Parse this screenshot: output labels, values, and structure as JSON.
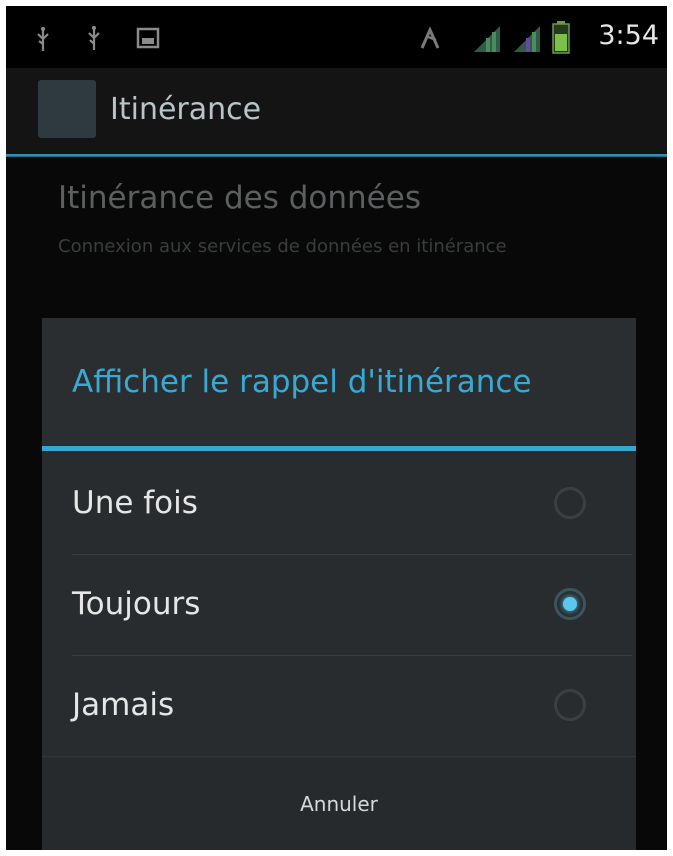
{
  "status_bar": {
    "time": "3:54",
    "icons": [
      "usb-icon",
      "usb-icon",
      "sd-card-icon",
      "vibrate-icon",
      "signal-icon",
      "signal-icon",
      "battery-icon"
    ]
  },
  "action_bar": {
    "title": "Itinérance",
    "app_icon": "settings-app-icon"
  },
  "preference": {
    "title": "Itinérance des données",
    "summary": "Connexion aux services de données en itinérance"
  },
  "dialog": {
    "title": "Afficher le rappel d'itinérance",
    "options": [
      {
        "label": "Une fois",
        "checked": false
      },
      {
        "label": "Toujours",
        "checked": true
      },
      {
        "label": "Jamais",
        "checked": false
      }
    ],
    "cancel_label": "Annuler"
  },
  "colors": {
    "accent": "#35a8d0",
    "background": "#0b0b0b",
    "dialog": "#282c2e"
  }
}
